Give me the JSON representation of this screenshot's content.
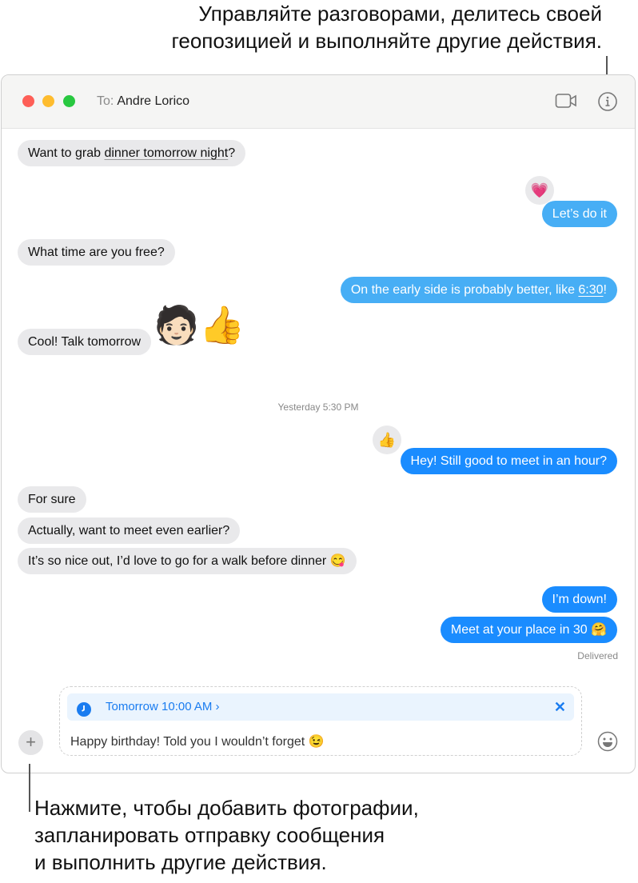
{
  "annotations": {
    "top": [
      "Управляйте разговорами, делитесь своей",
      "геопозицией и выполняйте другие действия."
    ],
    "bottom": [
      "Нажмите, чтобы добавить фотографии,",
      "запланировать отправку сообщения",
      "и выполнить другие действия."
    ]
  },
  "window": {
    "to_label": "To:",
    "recipient": "Andre Lorico",
    "icons": [
      "video-camera-icon",
      "info-icon"
    ]
  },
  "messages": [
    {
      "dir": "in",
      "pre": "Want to grab ",
      "link": "dinner tomorrow night",
      "post": "?"
    },
    {
      "dir": "out",
      "text": "Let’s do it",
      "tapback": "💗"
    },
    {
      "dir": "in",
      "text": "What time are you free?"
    },
    {
      "dir": "out",
      "pre": "On the early side is probably better, like ",
      "link": "6:30",
      "post": "!"
    },
    {
      "dir": "in",
      "text": "Cool! Talk tomorrow",
      "sticker": "🧑🏻👍"
    },
    {
      "timestamp": "Yesterday 5:30 PM"
    },
    {
      "dir": "out",
      "text": "Hey! Still good to meet in an hour?",
      "tapback": "👍"
    },
    {
      "dir": "in",
      "text": "For sure"
    },
    {
      "dir": "in",
      "text": "Actually, want to meet even earlier?"
    },
    {
      "dir": "in",
      "text": "It’s so nice out, I’d love to go for a walk before dinner 😋"
    },
    {
      "dir": "out",
      "text": "I’m down!"
    },
    {
      "dir": "out",
      "text": "Meet at your place in 30 🤗"
    }
  ],
  "status": "Delivered",
  "composer": {
    "schedule": "Tomorrow 10:00 AM ›",
    "text": "Happy birthday! Told you I wouldn’t forget 😉",
    "plus": "+"
  },
  "colors": {
    "blue": "#1a8cff",
    "light_blue": "#47aef5",
    "gray_bubble": "#e9e9eb"
  }
}
